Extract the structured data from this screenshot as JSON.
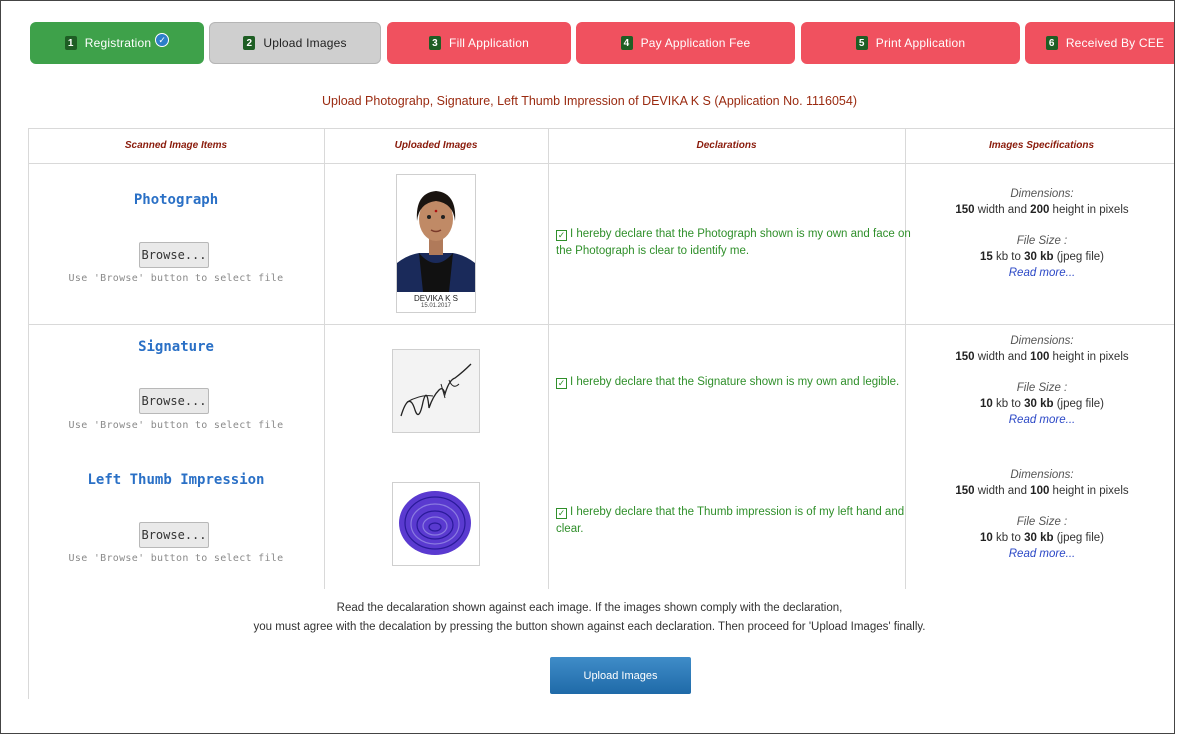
{
  "tabs": [
    {
      "num": "1",
      "label": "Registration"
    },
    {
      "num": "2",
      "label": "Upload Images"
    },
    {
      "num": "3",
      "label": "Fill Application"
    },
    {
      "num": "4",
      "label": "Pay Application Fee"
    },
    {
      "num": "5",
      "label": "Print Application"
    },
    {
      "num": "6",
      "label": "Received By CEE"
    }
  ],
  "heading": "Upload Photograhp, Signature, Left Thumb Impression of DEVIKA K S (Application No.  1116054)",
  "table": {
    "headers": [
      "Scanned Image Items",
      "Uploaded Images",
      "Declarations",
      "Images Specifications"
    ]
  },
  "rows": [
    {
      "title": "Photograph",
      "browse": "Browse...",
      "hint": "Use 'Browse' button to select file",
      "caption_name": "DEVIKA K S",
      "caption_date": "15.01.2017",
      "declaration": "I hereby declare that the Photograph shown is my own and face on the Photograph is clear to identify me.",
      "dim_label": "Dimensions:",
      "dim_value_a": "150",
      "dim_mid": " width and ",
      "dim_value_b": "200",
      "dim_tail": " height in pixels",
      "size_label": "File Size :",
      "size_a": "15",
      "size_mid": " kb to ",
      "size_b": "30 kb",
      "size_tail": " (jpeg file)",
      "read_more": "Read more..."
    },
    {
      "title": "Signature",
      "browse": "Browse...",
      "hint": "Use 'Browse' button to select file",
      "declaration": "I hereby declare that the Signature shown is my own and legible.",
      "dim_label": "Dimensions:",
      "dim_value_a": "150",
      "dim_mid": " width and ",
      "dim_value_b": "100",
      "dim_tail": " height in pixels",
      "size_label": "File Size :",
      "size_a": "10",
      "size_mid": " kb to ",
      "size_b": "30 kb",
      "size_tail": " (jpeg file)",
      "read_more": "Read more..."
    },
    {
      "title": "Left Thumb Impression",
      "browse": "Browse...",
      "hint": "Use 'Browse' button to select file",
      "declaration": "I hereby declare that the Thumb impression is of my left hand and clear.",
      "dim_label": "Dimensions:",
      "dim_value_a": "150",
      "dim_mid": " width and ",
      "dim_value_b": "100",
      "dim_tail": " height in pixels",
      "size_label": "File Size :",
      "size_a": "10",
      "size_mid": " kb to ",
      "size_b": "30 kb",
      "size_tail": " (jpeg file)",
      "read_more": "Read more..."
    }
  ],
  "note_line1": "Read the decalaration shown against each image. If the images shown comply with the declaration,",
  "note_line2": "you must agree with the decalation by pressing the button shown against each declaration. Then proceed for 'Upload Images' finally.",
  "upload_button": "Upload Images",
  "colors": {
    "green_tab": "#3ea14a",
    "red_tab": "#f0515f",
    "gray_tab": "#cfcfcf",
    "heading": "#9a2a10",
    "decl": "#2f8f2a",
    "link": "#2a70c6"
  }
}
